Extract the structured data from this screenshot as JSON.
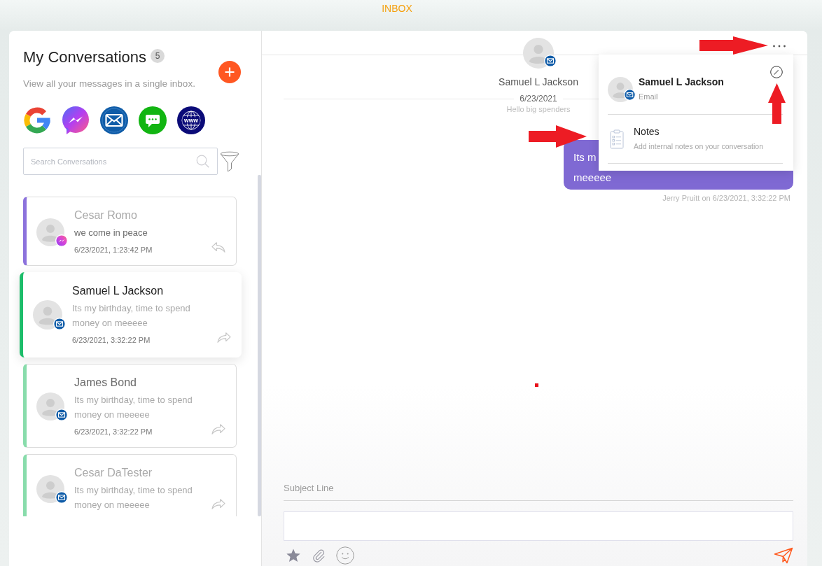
{
  "header": {
    "title": "INBOX"
  },
  "sidebar": {
    "title": "My Conversations",
    "count": "5",
    "subtitle": "View all your messages in a single inbox.",
    "channels": [
      {
        "kind": "google"
      },
      {
        "kind": "messenger"
      },
      {
        "kind": "email"
      },
      {
        "kind": "sms"
      },
      {
        "kind": "web",
        "label": "www"
      }
    ],
    "search": {
      "placeholder": "Search Conversations"
    }
  },
  "conversations": [
    {
      "name": "Cesar Romo",
      "channel": {
        "kind": "messenger"
      },
      "preview": "we come in peace",
      "time": "6/23/2021, 1:23:42 PM",
      "outgoing": false,
      "selected": false,
      "name_faded": true,
      "preview_faded": false,
      "color": "#8c72dc"
    },
    {
      "name": "Samuel L Jackson",
      "channel": {
        "kind": "email"
      },
      "preview": "Its my birthday, time to spend money on meeeee",
      "time": "6/23/2021, 3:32:22 PM",
      "outgoing": true,
      "selected": true,
      "name_faded": false,
      "preview_faded": true,
      "color": "#1dbd6a"
    },
    {
      "name": "James Bond",
      "channel": {
        "kind": "email"
      },
      "preview": "Its my birthday, time to spend money on meeeee",
      "time": "6/23/2021, 3:32:22 PM",
      "outgoing": true,
      "selected": false,
      "name_faded": false,
      "preview_faded": true,
      "color": "#88dcab"
    },
    {
      "name": "Cesar DaTester",
      "channel": {
        "kind": "email"
      },
      "preview": "Its my birthday, time to spend money on meeeee",
      "outgoing": true,
      "selected": false,
      "name_faded": true,
      "preview_faded": true,
      "color": "#88dcab"
    }
  ],
  "chat": {
    "contact": {
      "name": "Samuel L Jackson",
      "channel": {
        "kind": "email"
      }
    },
    "date": "6/23/2021",
    "subject": "Hello big spenders",
    "messages": [
      {
        "outgoing": true,
        "lines": [
          "Its m",
          "meeeee"
        ],
        "meta": "Jerry Pruitt on 6/23/2021, 3:32:22 PM"
      }
    ]
  },
  "contact_panel": {
    "open": true,
    "name": "Samuel L Jackson",
    "channel": {
      "kind": "email"
    },
    "channel_label": "Email",
    "items": [
      {
        "kind": "notes",
        "title": "Notes",
        "description": "Add internal notes on your conversation"
      }
    ]
  },
  "composer": {
    "subject": {
      "placeholder": "Subject Line"
    }
  }
}
